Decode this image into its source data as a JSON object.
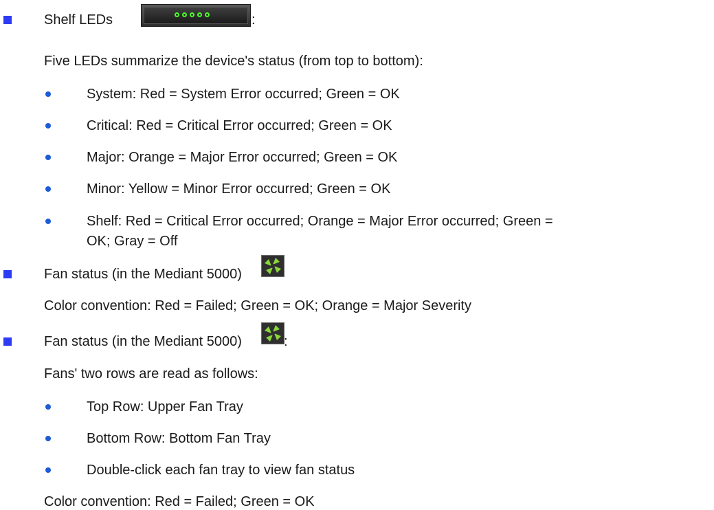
{
  "items": [
    {
      "label": "Shelf LEDs",
      "suffix": ":"
    },
    {
      "label": "Fan status (in the Mediant 5000)",
      "suffix": ""
    },
    {
      "label": "Fan status (in the Mediant 5000)",
      "suffix": ":"
    }
  ],
  "shelf_leds": {
    "intro": "Five LEDs summarize the device's status (from top to bottom):",
    "bullets": [
      "System: Red = System Error occurred; Green = OK",
      "Critical: Red = Critical Error occurred; Green = OK",
      "Major: Orange = Major Error occurred; Green = OK",
      "Minor: Yellow = Minor Error occurred; Green = OK",
      "Shelf: Red = Critical Error occurred; Orange = Major Error occurred; Green =",
      "OK; Gray = Off"
    ]
  },
  "fan1": {
    "convention": "Color convention: Red = Failed; Green = OK; Orange = Major Severity"
  },
  "fan2": {
    "intro": "Fans' two rows are read as follows:",
    "bullets": [
      "Top Row: Upper Fan Tray",
      "Bottom Row: Bottom Fan Tray",
      "Double-click each fan tray to view fan status"
    ],
    "convention": "Color convention: Red = Failed; Green = OK"
  },
  "colors": {
    "square_bullet": "#2e3bf5",
    "round_bullet": "#1e5bd6",
    "led": "#4cff2a",
    "fan": "#8ad63a"
  },
  "icons": [
    "shelf-leds-icon",
    "fan-status-icon"
  ]
}
